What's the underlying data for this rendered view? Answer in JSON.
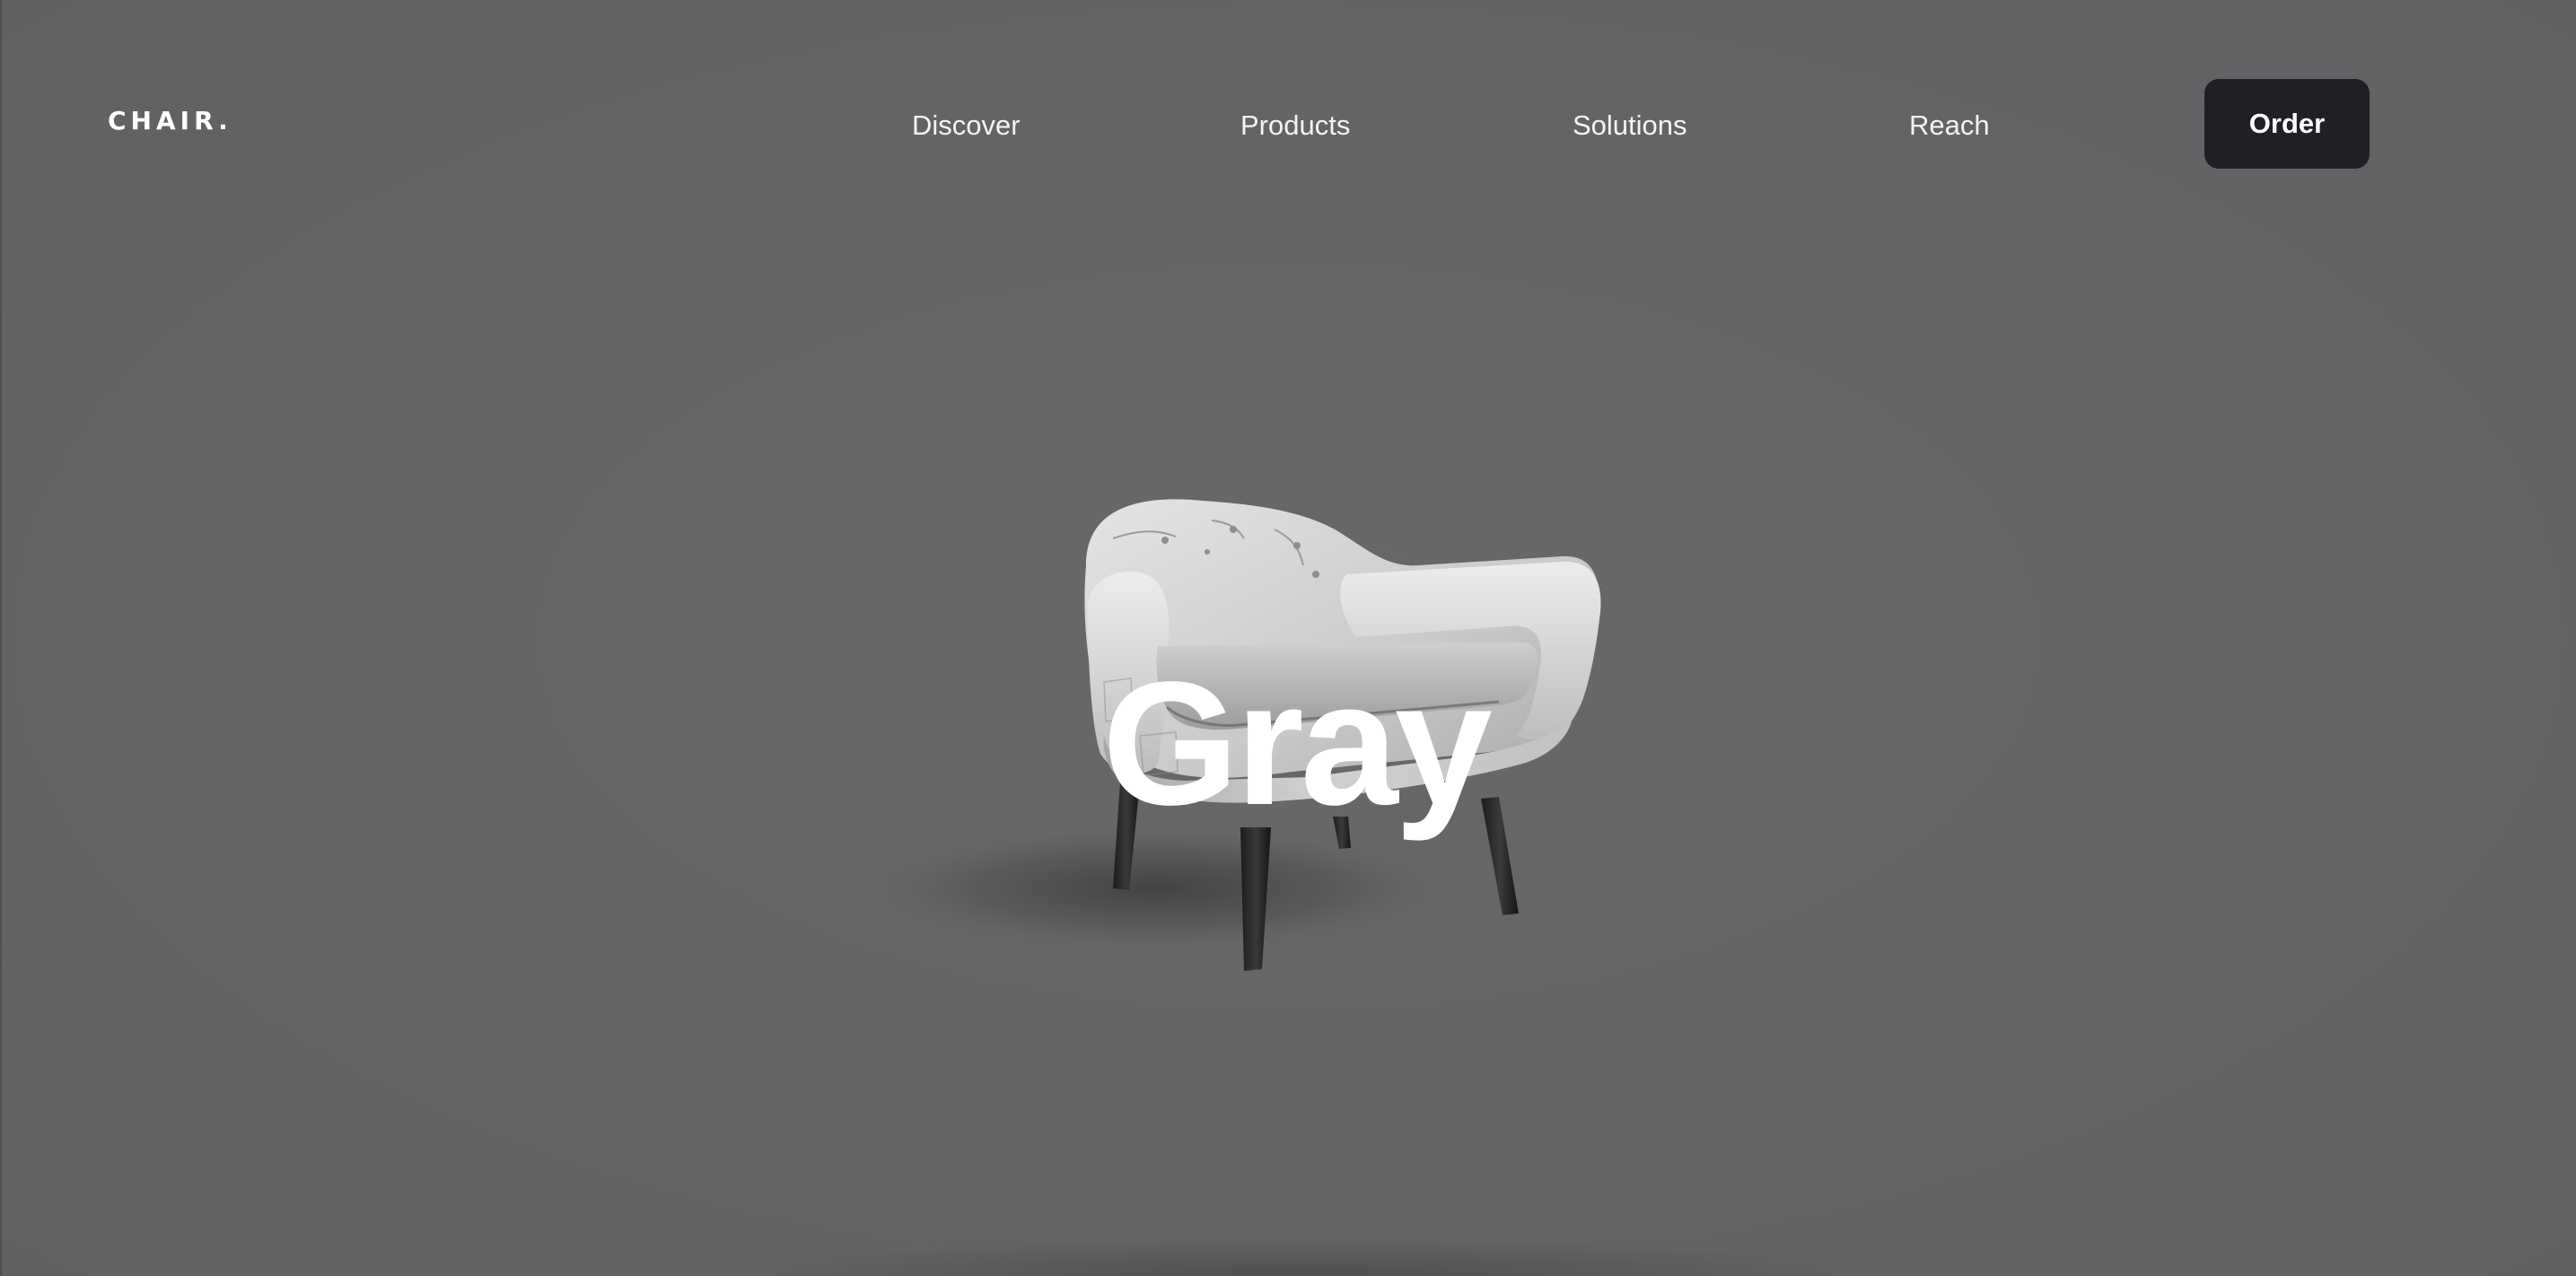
{
  "header": {
    "logo": "CHAIR.",
    "nav": [
      {
        "label": "Discover"
      },
      {
        "label": "Products"
      },
      {
        "label": "Solutions"
      },
      {
        "label": "Reach"
      }
    ],
    "cta_label": "Order"
  },
  "hero": {
    "title": "Gray",
    "image": "armchair-photo"
  },
  "colors": {
    "background": "#636466",
    "button_bg": "#202024",
    "text": "#ffffff"
  }
}
